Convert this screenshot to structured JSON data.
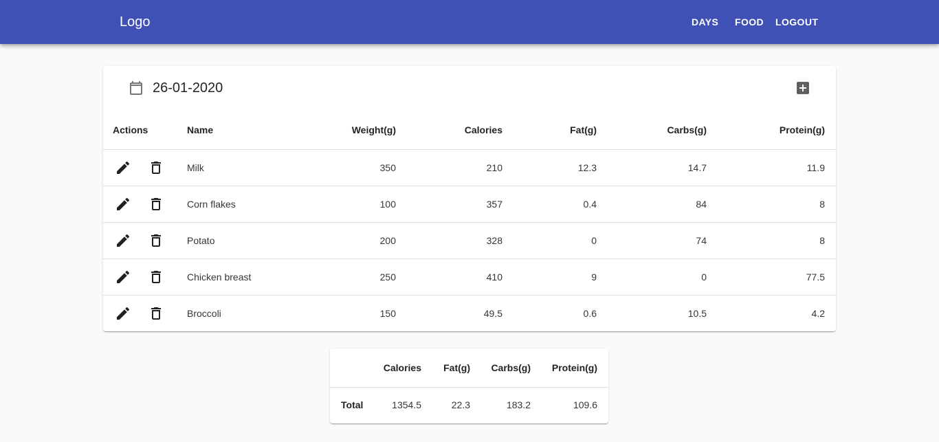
{
  "app": {
    "logo": "Logo",
    "nav": {
      "days": "DAYS",
      "food": "FOOD",
      "logout": "LOGOUT"
    },
    "colors": {
      "primary": "#3f51b5",
      "background": "#fafafa"
    }
  },
  "day": {
    "date": "26-01-2020",
    "calendar_icon": "calendar-icon",
    "add_icon": "add-box-icon"
  },
  "table": {
    "headers": {
      "actions": "Actions",
      "name": "Name",
      "weight": "Weight(g)",
      "calories": "Calories",
      "fat": "Fat(g)",
      "carbs": "Carbs(g)",
      "protein": "Protein(g)"
    },
    "rows": [
      {
        "name": "Milk",
        "weight": "350",
        "calories": "210",
        "fat": "12.3",
        "carbs": "14.7",
        "protein": "11.9"
      },
      {
        "name": "Corn flakes",
        "weight": "100",
        "calories": "357",
        "fat": "0.4",
        "carbs": "84",
        "protein": "8"
      },
      {
        "name": "Potato",
        "weight": "200",
        "calories": "328",
        "fat": "0",
        "carbs": "74",
        "protein": "8"
      },
      {
        "name": "Chicken breast",
        "weight": "250",
        "calories": "410",
        "fat": "9",
        "carbs": "0",
        "protein": "77.5"
      },
      {
        "name": "Broccoli",
        "weight": "150",
        "calories": "49.5",
        "fat": "0.6",
        "carbs": "10.5",
        "protein": "4.2"
      }
    ],
    "row_icons": {
      "edit": "pencil-icon",
      "delete": "trash-icon"
    }
  },
  "totals": {
    "headers": {
      "calories": "Calories",
      "fat": "Fat(g)",
      "carbs": "Carbs(g)",
      "protein": "Protein(g)"
    },
    "label": "Total",
    "calories": "1354.5",
    "fat": "22.3",
    "carbs": "183.2",
    "protein": "109.6"
  }
}
